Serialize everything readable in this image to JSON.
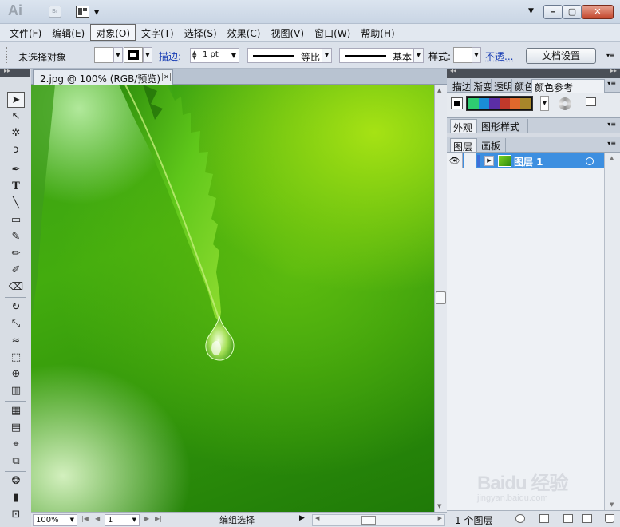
{
  "app": {
    "logo": "Ai",
    "bridge": "Br"
  },
  "menu": [
    "文件(F)",
    "编辑(E)",
    "对象(O)",
    "文字(T)",
    "选择(S)",
    "效果(C)",
    "视图(V)",
    "窗口(W)",
    "帮助(H)"
  ],
  "control_bar": {
    "selection_status": "未选择对象",
    "stroke_label": "描边:",
    "stroke_weight": "1 pt",
    "variable_width": "等比",
    "brush": "基本",
    "style_label": "样式:",
    "opacity_link": "不透...",
    "doc_setup": "文档设置"
  },
  "document": {
    "tab_title": "2.jpg @ 100% (RGB/预览)"
  },
  "status_bar": {
    "zoom": "100%",
    "page": "1",
    "status": "编组选择"
  },
  "panels": {
    "top_tabs": [
      "描边",
      "渐变",
      "透明",
      "颜色",
      "颜色参考"
    ],
    "color_guide_colors": [
      "#2ecc71",
      "#1a8dd6",
      "#5b2ea6",
      "#c0392b",
      "#e0682c",
      "#a7862a"
    ],
    "appearance_tabs": [
      "外观",
      "图形样式"
    ],
    "layers_tabs": [
      "图层",
      "画板"
    ],
    "layer_name": "图层 1",
    "layer_count": "1 个图层"
  },
  "watermark": {
    "logo": "Baidu 经验",
    "sub": "jingyan.baidu.com"
  },
  "colors": {
    "selection": "#3d8fe0",
    "accent_link": "#1a3fb5"
  }
}
